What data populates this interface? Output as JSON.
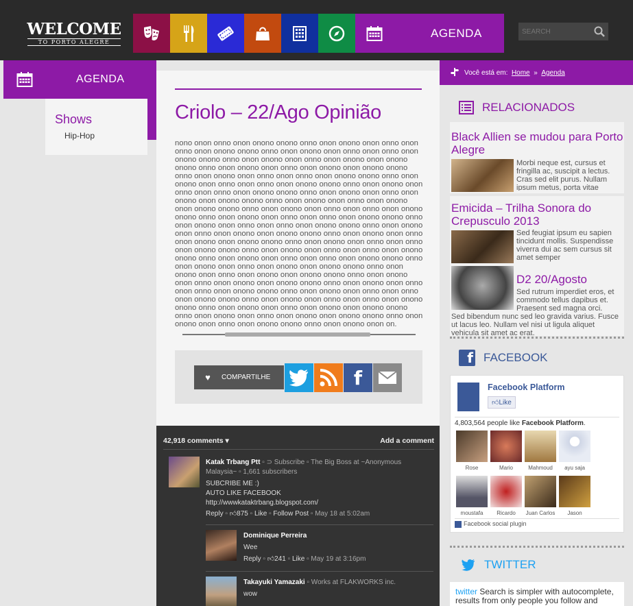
{
  "header": {
    "logo_big": "WELCOME",
    "logo_small": "TO PORTO ALEGRE",
    "nav": [
      {
        "icon": "theater-masks-icon",
        "color": "#8c1046"
      },
      {
        "icon": "fork-knife-icon",
        "color": "#d6a418"
      },
      {
        "icon": "ticket-icon",
        "color": "#2a2ad6"
      },
      {
        "icon": "shopping-bag-icon",
        "color": "#c24a0f"
      },
      {
        "icon": "building-icon",
        "color": "#10309e"
      },
      {
        "icon": "compass-icon",
        "color": "#0f8c45"
      }
    ],
    "agenda_label": "AGENDA",
    "search_placeholder": "SEARCH"
  },
  "sidebar": {
    "title": "AGENDA",
    "category": "Shows",
    "subcategory": "Hip-Hop"
  },
  "article": {
    "title": "Criolo – 22/Ago Opinião",
    "body": "nono onon onno onon onono onono onno onon onono onon onno onon onno onon onono onono onno onon onono onon onno onon onno onon onono onono onno onon onono onon onno onon onono onon onono onono onno onon onono onon onno onon onono onon onono onono onno onon onono onon onno onon onno onon onono onono onno onon onono onon onno onon onno onon onono onono onno onon onono onon onno onon onno onon onono onono onno onon onono onon onno onon onono onon onono onono onno onon onono onon onno onon onono onon onono onono onno onon onono onon onno onon onno onon onono onono onno onon onono onon onno onon onno onon onono onono onno onon onono onon onno onon onno onon onono onono onno onon onono onon onno onon onono onon onono onono onno onon onono onon onno onon onono onon onono onono onno onon onono onon onno onon onno onon onono onono onno onon onono onon onno onon onno onon onono onono onno onon onono onon onno onon onno onon onono onono onno onon onono onon onno onon onono onon onono onono onno onon onono onon onno onon onono onon onono onono onno onon onono onon onno onon onono onon onono onono onno onon onono onon onno onon onno onon onono onono onno onon onono onon onno onon onno onon onono onono onno onon onono onon onno onon onno onon onono onono onno onon onono onon onno onon onono onon onono onono onno onon onono onon onno onon onono onon onono onono onno onon onono onon onno onon onono onono onno onon onono onon on.",
    "share_label": "COMPARTILHE"
  },
  "comments": {
    "count": "42,918 comments ▾",
    "add": "Add a comment",
    "items": [
      {
        "name": "Katak Trbang Ptt",
        "meta1": " ▫ ⊃ Subscribe ▫ The Big Boss at ~Anonymous",
        "meta2": "Malaysia~ ▫ 1,661 subscribers",
        "text1": "SUBCRIBE ME :)",
        "text2": "AUTO LIKE FACEBOOK",
        "text3": "http://wwwkataktrbang.blogspot.com/",
        "reply": "Reply",
        "likes": "875",
        "like": "Like",
        "follow": "Follow Post",
        "date": "May 18 at 5:02am"
      },
      {
        "name": "Dominique Perreira",
        "text": "Wee",
        "reply": "Reply",
        "likes": "241",
        "like": "Like",
        "date": "May 19 at 3:16pm"
      },
      {
        "name": "Takayuki Yamazaki",
        "meta": " ▫ Works at FLAKWORKS inc.",
        "text": "wow"
      }
    ]
  },
  "breadcrumb": {
    "prefix": "Você está em:",
    "home": "Home",
    "sep": "»",
    "current": "Agenda"
  },
  "related": {
    "title": "RELACIONADOS",
    "items": [
      {
        "title": "Black Allien se mudou para Porto Alegre",
        "text": "Morbi neque est, cursus et fringilla ac, suscipit a lectus. Cras sed elit purus. Nullam ipsum metus, porta vitae"
      },
      {
        "title": "Emicida – Trilha Sonora do Crepusculo 2013",
        "text": "Sed feugiat ipsum eu sapien tincidunt mollis. Suspendisse viverra dui ac sem cursus sit amet semper"
      },
      {
        "title": "D2 20/Agosto",
        "text": "Sed rutrum imperdiet eros, et commodo tellus dapibus et. Praesent sed magna orci.",
        "text_full": "Sed bibendum nunc sed leo gravida varius. Fusce ut lacus leo. Nullam vel nisi ut ligula aliquet vehicula sit amet ac erat."
      }
    ]
  },
  "facebook": {
    "title": "FACEBOOK",
    "page": "Facebook Platform",
    "like_btn": "Like",
    "count_text": "4,803,564 people like",
    "count_page": "Facebook Platform",
    "faces": [
      "Rose",
      "Mario",
      "Mahmoud",
      "ayu saja",
      "moustafa",
      "Ricardo",
      "Juan Carlos",
      "Jason"
    ],
    "plugin": "Facebook social plugin"
  },
  "twitter": {
    "title": "TWITTER",
    "brand": "twitter",
    "text": "Search is simpler with autocomplete, results from only people you follow and more"
  }
}
